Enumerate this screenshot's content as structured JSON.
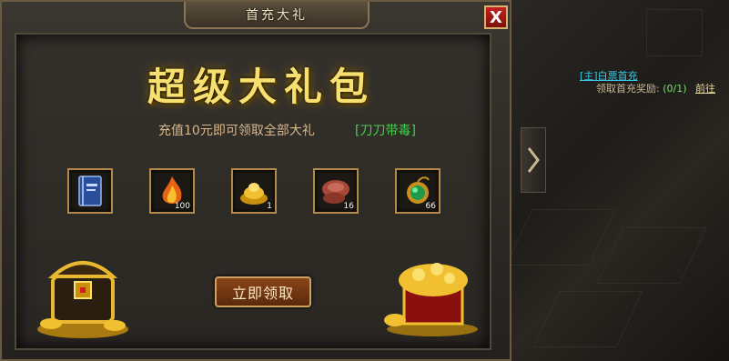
{
  "window": {
    "title": "首充大礼",
    "close_label": "X"
  },
  "banner": {
    "headline": "超级大礼包",
    "subtitle": "充值10元即可领取全部大礼",
    "highlight": "[刀刀带毒]"
  },
  "rewards": [
    {
      "icon": "book-icon",
      "count": ""
    },
    {
      "icon": "fire-icon",
      "count": "100"
    },
    {
      "icon": "gold-pile-icon",
      "count": "1"
    },
    {
      "icon": "mushroom-icon",
      "count": "16"
    },
    {
      "icon": "jade-pendant-icon",
      "count": "66"
    }
  ],
  "claim_button": {
    "label": "立即领取"
  },
  "quest_tracker": {
    "title": "[主]白票首充",
    "task": "领取首充奖励:",
    "progress": "(0/1)",
    "go_label": "前往"
  },
  "colors": {
    "headline": "#f8e070",
    "highlight": "#45d24a",
    "close": "#c2221e",
    "quest_link": "#36c8e8"
  }
}
